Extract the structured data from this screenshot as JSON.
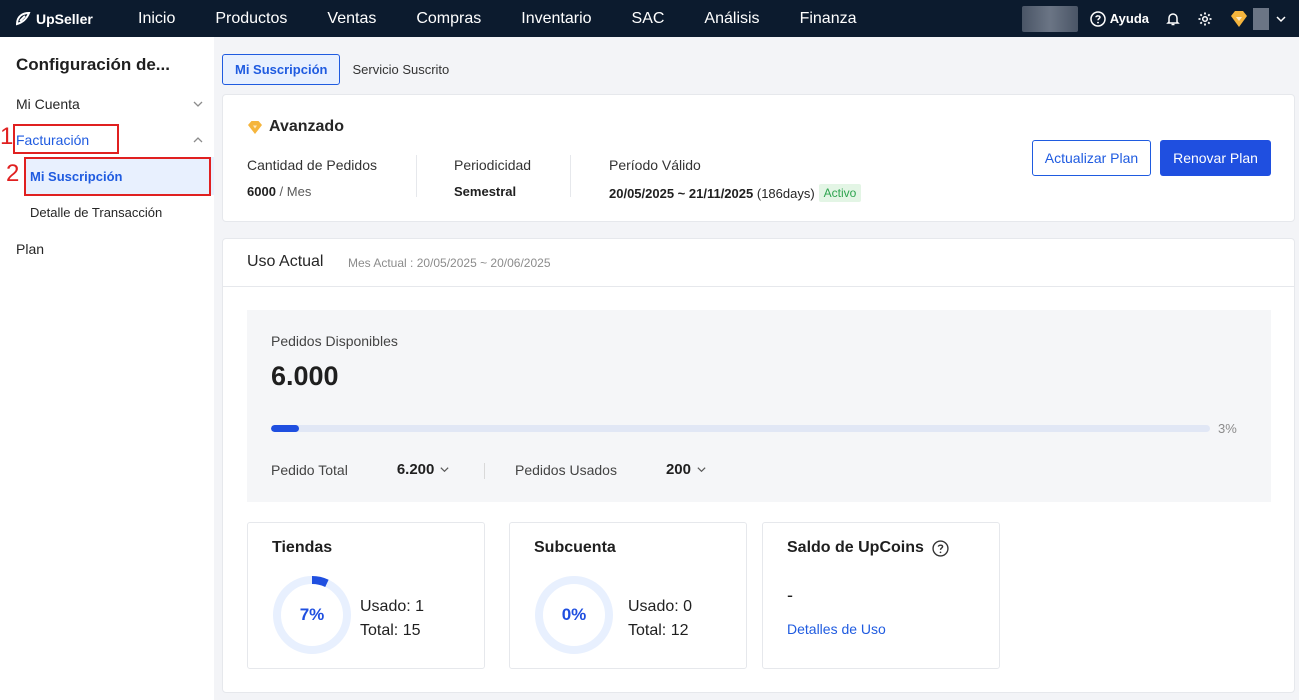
{
  "nav": {
    "logo": "UpSeller",
    "items": [
      "Inicio",
      "Productos",
      "Ventas",
      "Compras",
      "Inventario",
      "SAC",
      "Análisis",
      "Finanza"
    ],
    "help": "Ayuda"
  },
  "sidebar": {
    "title": "Configuración de...",
    "items": [
      {
        "label": "Mi Cuenta"
      },
      {
        "label": "Facturación"
      },
      {
        "label": "Mi Suscripción"
      },
      {
        "label": "Detalle de Transacción"
      },
      {
        "label": "Plan"
      }
    ],
    "markers": [
      "1",
      "2"
    ]
  },
  "tabs": [
    "Mi Suscripción",
    "Servicio Suscrito"
  ],
  "plan": {
    "name": "Avanzado",
    "orders_label": "Cantidad de Pedidos",
    "orders_value": "6000",
    "orders_unit": "/ Mes",
    "period_label": "Periodicidad",
    "period_value": "Semestral",
    "valid_label": "Período Válido",
    "valid_range": "20/05/2025 ~ 21/11/2025",
    "valid_days": "(186days)",
    "status": "Activo",
    "btn_update": "Actualizar Plan",
    "btn_renew": "Renovar Plan"
  },
  "usage": {
    "title": "Uso Actual",
    "month": "Mes Actual : 20/05/2025 ~ 20/06/2025",
    "available_label": "Pedidos Disponibles",
    "available_value": "6.000",
    "progress_pct": 3,
    "progress_label": "3%",
    "total_label": "Pedido Total",
    "total_value": "6.200",
    "used_label": "Pedidos Usados",
    "used_value": "200"
  },
  "stores": {
    "title": "Tiendas",
    "pct": 7,
    "pct_label": "7%",
    "used": "Usado: 1",
    "total": "Total: 15"
  },
  "subaccount": {
    "title": "Subcuenta",
    "pct": 0,
    "pct_label": "0%",
    "used": "Usado: 0",
    "total": "Total: 12"
  },
  "upcoins": {
    "title": "Saldo de UpCoins",
    "value": "-",
    "link": "Detalles de Uso"
  },
  "colors": {
    "accent": "#1f4fe0",
    "nav_bg": "#0c1b2e",
    "marker": "#e02020",
    "active_badge": "#2ea44f"
  }
}
